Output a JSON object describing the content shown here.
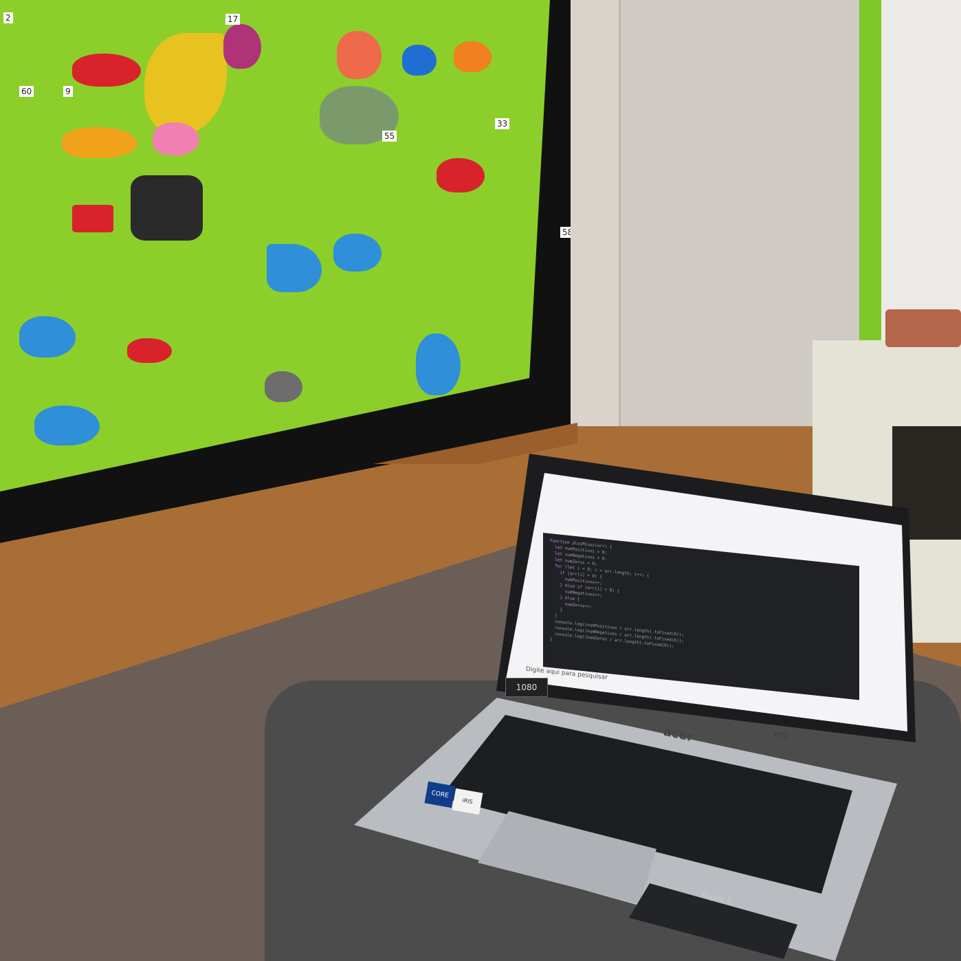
{
  "scene": {
    "description_elements": [
      "climbing-wall",
      "door",
      "shelf",
      "rug",
      "ottoman",
      "laptop"
    ]
  },
  "wall_tags": [
    "2",
    "17",
    "60",
    "9",
    "33",
    "55",
    "58"
  ],
  "laptop": {
    "brand": "acer",
    "model": "Aspire 5",
    "badge_intel_core": "CORE",
    "badge_intel_iris": "iRIS",
    "resolution_badge": "1080"
  },
  "screen": {
    "taskbar_search_placeholder": "Digite aqui para pesquisar",
    "weather": "20°C"
  },
  "colors": {
    "wall_green": "#8ccf2a",
    "floor_wood": "#a86e36",
    "rug_brown": "#6b5e57",
    "devtools_bg": "#202124"
  }
}
